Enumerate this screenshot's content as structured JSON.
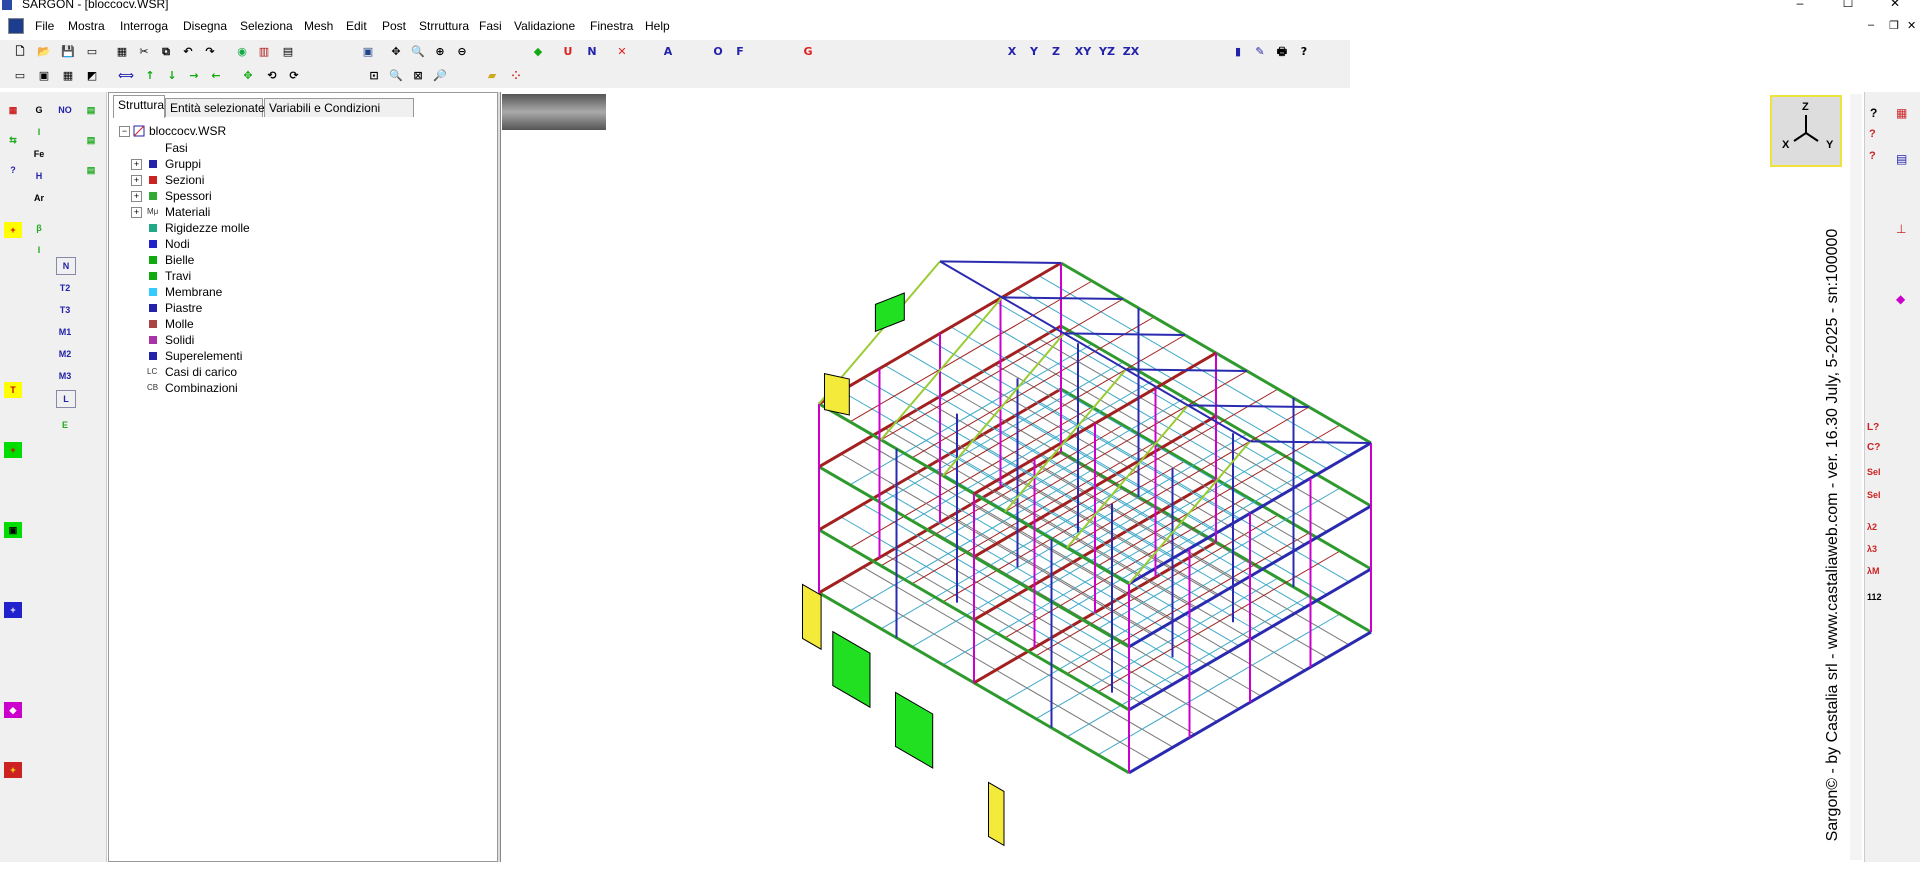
{
  "window": {
    "title": "SARGON - [bloccocv.WSR]",
    "min": "–",
    "max": "☐",
    "close": "✕"
  },
  "menu": [
    "File",
    "Mostra",
    "Interroga",
    "Disegna",
    "Seleziona",
    "Mesh",
    "Edit",
    "Post",
    "Strruttura",
    "Fasi",
    "Validazione",
    "Finestra",
    "Help"
  ],
  "tabs": [
    "Struttura",
    "Entità selezionate",
    "Variabili e Condizioni"
  ],
  "tree": {
    "root": "bloccocv.WSR",
    "items": [
      {
        "label": "Fasi",
        "expandable": false
      },
      {
        "label": "Gruppi",
        "expandable": true
      },
      {
        "label": "Sezioni",
        "expandable": true
      },
      {
        "label": "Spessori",
        "expandable": true
      },
      {
        "label": "Materiali",
        "expandable": true
      },
      {
        "label": "Rigidezze molle",
        "expandable": false
      },
      {
        "label": "Nodi",
        "expandable": false
      },
      {
        "label": "Bielle",
        "expandable": false
      },
      {
        "label": "Travi",
        "expandable": false
      },
      {
        "label": "Membrane",
        "expandable": false
      },
      {
        "label": "Piastre",
        "expandable": false
      },
      {
        "label": "Molle",
        "expandable": false
      },
      {
        "label": "Solidi",
        "expandable": false
      },
      {
        "label": "Superelementi",
        "expandable": false
      },
      {
        "label": "Casi di carico",
        "expandable": false
      },
      {
        "label": "Combinazioni",
        "expandable": false
      }
    ],
    "icon_prefix": {
      "Materiali": "Mμ",
      "Casi di carico": "LC",
      "Combinazioni": "CB"
    }
  },
  "axes_labels": {
    "z": "Z",
    "x": "X",
    "y": "Y"
  },
  "watermark": "Sargon© - by Castalia srl - www.castaliaweb.com - ver. 16.30 July, 5-2025 - sn:100000",
  "toolbar_text": {
    "u": "U",
    "n": "N",
    "a": "A",
    "o": "O",
    "f": "F",
    "g": "G",
    "x": "X",
    "y": "Y",
    "z": "Z",
    "xy": "XY",
    "yz": "YZ",
    "zx": "ZX"
  },
  "left_tools": {
    "col2": [
      "G",
      "I",
      "Fe",
      "H",
      "Ar",
      "β",
      "I"
    ],
    "col3": [
      "NO",
      "N",
      "T2",
      "T3",
      "M1",
      "M2",
      "M3",
      "L",
      "E"
    ],
    "right": [
      "?",
      "?",
      "L?",
      "C?",
      "Sel",
      "Sel",
      "λ2",
      "λ3",
      "λM",
      "112"
    ]
  },
  "colors": {
    "toolbar_bg": "#f0f0f0",
    "frame_green": "#2e9a2e",
    "frame_red": "#a32020",
    "frame_blue": "#2a2ab0",
    "frame_cyan": "#3fa9c8",
    "yellow": "#f3ea3a",
    "green": "#21e021"
  }
}
